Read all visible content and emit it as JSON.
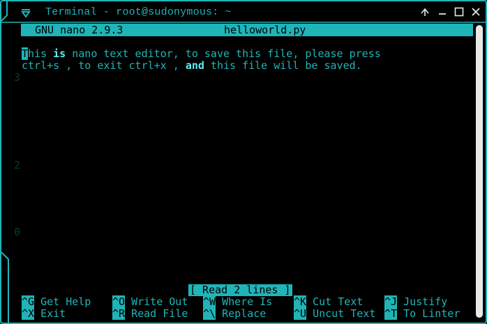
{
  "window": {
    "title": "Terminal - root@sudonymous: ~",
    "accent_color": "#1fb5b8",
    "icons": {
      "menu": "window-menu-icon",
      "maximize_up": "arrow-up-icon",
      "minimize": "minimize-icon",
      "maximize": "maximize-icon",
      "close": "close-icon"
    }
  },
  "nano": {
    "version": "GNU nano 2.9.3",
    "filename": "helloworld.py",
    "content": {
      "line1": {
        "cursor_char": "T",
        "a": "his ",
        "kw1": "is",
        "b": " nano text editor, to save this file, please press"
      },
      "line2": {
        "a": "ctrl+s , to exit ctrl+x , ",
        "kw1": "and",
        "b": " this file will be saved."
      }
    },
    "status": "[ Read 2 lines ]",
    "shortcuts": [
      {
        "key": "^G",
        "label": " Get Help"
      },
      {
        "key": "^O",
        "label": " Write Out"
      },
      {
        "key": "^W",
        "label": " Where Is"
      },
      {
        "key": "^K",
        "label": " Cut Text"
      },
      {
        "key": "^J",
        "label": " Justify"
      },
      {
        "key": "^X",
        "label": " Exit"
      },
      {
        "key": "^R",
        "label": " Read File"
      },
      {
        "key": "^\\",
        "label": " Replace"
      },
      {
        "key": "^U",
        "label": " Uncut Text"
      },
      {
        "key": "^T",
        "label": " To Linter"
      }
    ]
  }
}
